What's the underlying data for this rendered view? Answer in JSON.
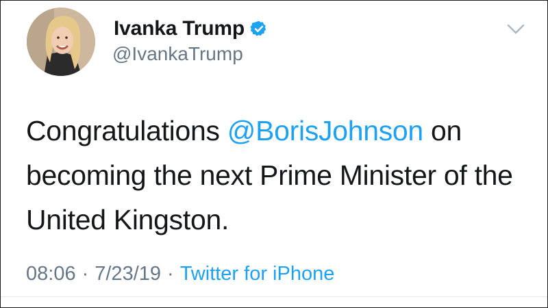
{
  "tweet": {
    "author": {
      "display_name": "Ivanka Trump",
      "handle": "@IvankaTrump",
      "verified": true,
      "avatar_icon": "profile-photo"
    },
    "text_before": "Congratulations ",
    "mention": "@BorisJohnson",
    "text_after": " on becoming the next Prime Minister of the United Kingston.",
    "time": "08:06",
    "date": "7/23/19",
    "separator": "·",
    "source": "Twitter for iPhone",
    "menu_icon": "chevron-down-icon"
  },
  "colors": {
    "text": "#14171a",
    "secondary": "#657786",
    "link": "#1da1f2",
    "verified_badge": "#1da1f2",
    "divider": "#e1e8ed"
  }
}
